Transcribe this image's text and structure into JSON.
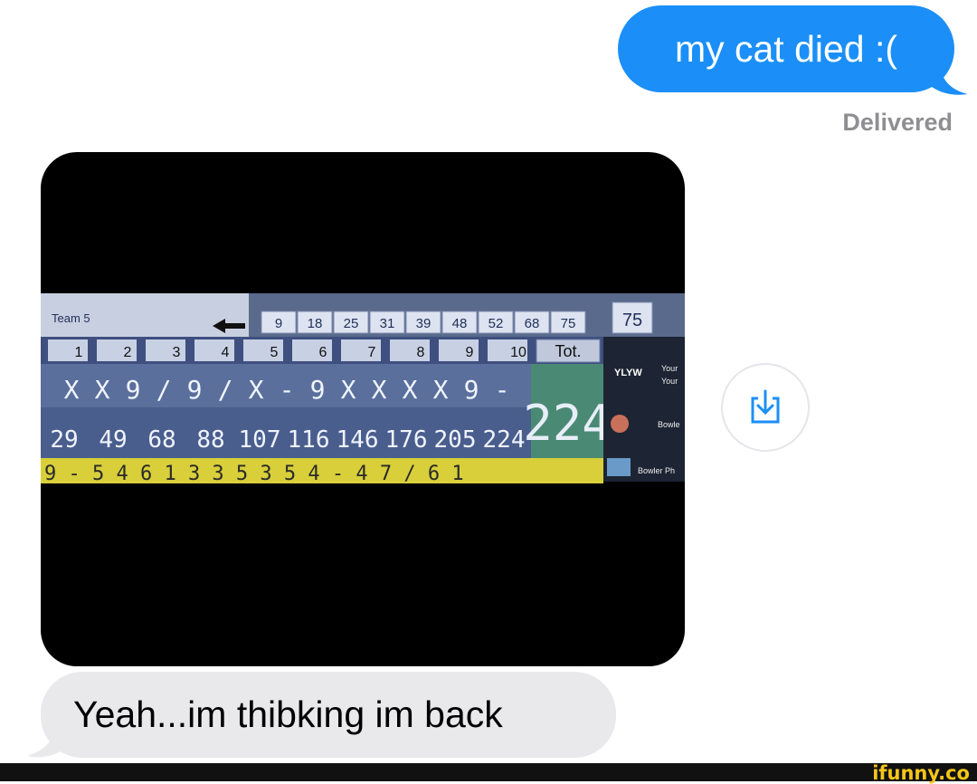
{
  "colors": {
    "sent_bubble": "#1b8ff7",
    "received_bubble": "#e9e9eb",
    "status_text": "#8e8e93",
    "watermark": "#f5c518"
  },
  "messages": {
    "sent": {
      "text": "my cat died :(",
      "status": "Delivered"
    },
    "received": {
      "text": "Yeah...im thibking im back"
    }
  },
  "photo": {
    "description_icon": "bowling-scoreboard-photo",
    "team_label": "Team 5",
    "score_row_top": [
      "9",
      "18",
      "25",
      "31",
      "39",
      "48",
      "52",
      "68",
      "75"
    ],
    "score_top_total": "75",
    "frame_numbers": [
      "1",
      "2",
      "3",
      "4",
      "5",
      "6",
      "7",
      "8",
      "9",
      "10"
    ],
    "tot_label": "Tot.",
    "marks": [
      "X",
      "X",
      "9",
      "/",
      "9",
      "/",
      "X",
      "-",
      "9",
      "X",
      "X",
      "X",
      "X",
      "9",
      "-"
    ],
    "cumulative": [
      "29",
      "49",
      "68",
      "88",
      "107",
      "116",
      "146",
      "176",
      "205",
      "224"
    ],
    "total": "224",
    "side_labels": [
      "YLYW",
      "Your",
      "Your",
      "Bowle",
      "Bowler Ph"
    ],
    "bottom_strip": "9 - 5 4 6 1 3 3 5 3 5 4 - 4 7 / 6 1"
  },
  "save_button_icon": "save-download-icon",
  "watermark": "ifunny.co"
}
